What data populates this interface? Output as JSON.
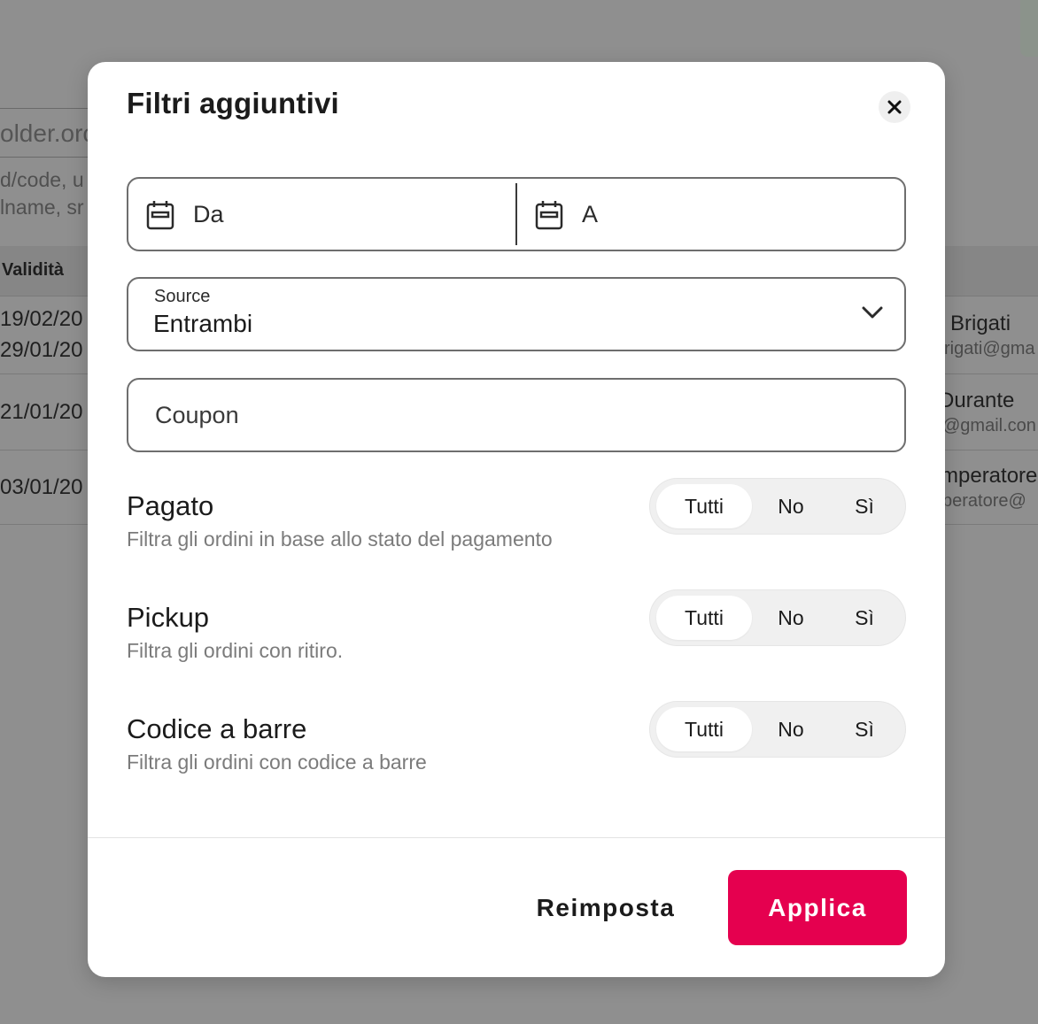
{
  "background": {
    "search_placeholder": "older.orc",
    "hint_line_1": "d/code, u",
    "hint_line_2": "lname, sr",
    "column_header": "Validità",
    "rows": [
      {
        "date_1": "19/02/20",
        "date_2": "29/01/20",
        "name": "Brigati",
        "email": "rigati@gma"
      },
      {
        "date_1": "21/01/20",
        "name": "Durante",
        "email": "@gmail.con"
      },
      {
        "date_1": "03/01/20",
        "name": "mperatore",
        "email": "peratore@"
      }
    ]
  },
  "modal": {
    "title": "Filtri aggiuntivi",
    "close_icon": "close-icon",
    "date_from_placeholder": "Da",
    "date_to_placeholder": "A",
    "calendar_icon": "calendar-icon",
    "source": {
      "label": "Source",
      "value": "Entrambi",
      "icon": "chevron-down-icon"
    },
    "coupon_placeholder": "Coupon",
    "filters": [
      {
        "title": "Pagato",
        "description": "Filtra gli ordini in base allo stato del pagamento",
        "options": [
          "Tutti",
          "No",
          "Sì"
        ],
        "selected": "Tutti"
      },
      {
        "title": "Pickup",
        "description": "Filtra gli ordini con ritiro.",
        "options": [
          "Tutti",
          "No",
          "Sì"
        ],
        "selected": "Tutti"
      },
      {
        "title": "Codice a barre",
        "description": "Filtra gli ordini con codice a barre",
        "options": [
          "Tutti",
          "No",
          "Sì"
        ],
        "selected": "Tutti"
      }
    ],
    "reset_label": "Reimposta",
    "apply_label": "Applica"
  },
  "colors": {
    "accent": "#e5004f",
    "overlay": "#8f8f8f",
    "segment_bg": "#f0f0f0"
  }
}
